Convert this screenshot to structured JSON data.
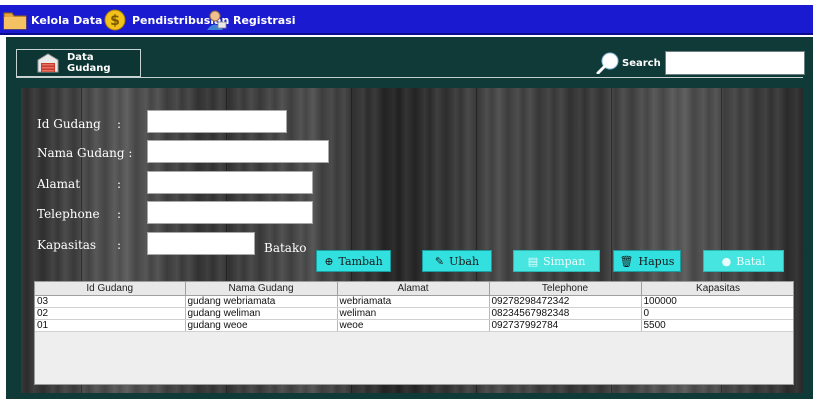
{
  "menubar": {
    "items": [
      {
        "label": "Kelola Data",
        "icon": "folder-icon"
      },
      {
        "label": "Pendistribusian",
        "icon": "coin-icon"
      },
      {
        "label": "Registrasi",
        "icon": "user-icon"
      }
    ]
  },
  "header": {
    "data_button_label": "Data Gudang",
    "data_button_icon": "warehouse-icon",
    "search_label": "Search",
    "search_value": ""
  },
  "form": {
    "fields": [
      {
        "label": "Id Gudang",
        "value": ""
      },
      {
        "label": "Nama Gudang :",
        "value": ""
      },
      {
        "label": "Alamat",
        "value": ""
      },
      {
        "label": "Telephone",
        "value": ""
      },
      {
        "label": "Kapasitas",
        "value": ""
      }
    ],
    "colon": ":",
    "kapasitas_unit": "Batako"
  },
  "actions": {
    "tambah": "Tambah",
    "ubah": "Ubah",
    "simpan": "Simpan",
    "hapus": "Hapus",
    "batal": "Batal"
  },
  "table": {
    "columns": [
      "Id Gudang",
      "Nama Gudang",
      "Alamat",
      "Telephone",
      "Kapasitas"
    ],
    "rows": [
      [
        "03",
        "gudang webriamata",
        "webriamata",
        "09278298472342",
        "100000"
      ],
      [
        "02",
        "gudang weliman",
        "weliman",
        "08234567982348",
        "0"
      ],
      [
        "01",
        "gudang weoe",
        "weoe",
        "092737992784",
        "5500"
      ]
    ]
  },
  "colors": {
    "menubar": "#1a1ad1",
    "app_background": "#103a38",
    "action_button": "#33e0e0"
  }
}
